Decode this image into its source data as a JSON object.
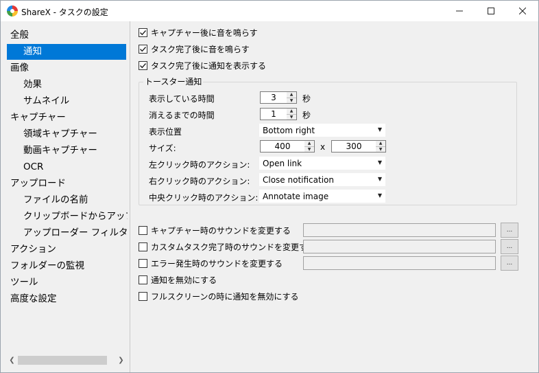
{
  "window": {
    "title": "ShareX - タスクの設定"
  },
  "nav": {
    "items": [
      {
        "label": "全般"
      },
      {
        "label": "通知"
      },
      {
        "label": "画像"
      },
      {
        "label": "効果"
      },
      {
        "label": "サムネイル"
      },
      {
        "label": "キャプチャー"
      },
      {
        "label": "領域キャプチャー"
      },
      {
        "label": "動画キャプチャー"
      },
      {
        "label": "OCR"
      },
      {
        "label": "アップロード"
      },
      {
        "label": "ファイルの名前"
      },
      {
        "label": "クリップボードからアップロー"
      },
      {
        "label": "アップローダー フィルター:"
      },
      {
        "label": "アクション"
      },
      {
        "label": "フォルダーの監視"
      },
      {
        "label": "ツール"
      },
      {
        "label": "高度な設定"
      }
    ],
    "selected": "通知"
  },
  "main": {
    "checks_top": [
      {
        "label": "キャプチャー後に音を鳴らす",
        "checked": true
      },
      {
        "label": "タスク完了後に音を鳴らす",
        "checked": true
      },
      {
        "label": "タスク完了後に通知を表示する",
        "checked": true
      }
    ],
    "toast": {
      "legend": "トースター通知",
      "display_time_label": "表示している時間",
      "display_time_value": "3",
      "display_time_unit": "秒",
      "fade_time_label": "消えるまでの時間",
      "fade_time_value": "1",
      "fade_time_unit": "秒",
      "position_label": "表示位置",
      "position_value": "Bottom right",
      "size_label": "サイズ:",
      "size_width": "400",
      "size_sep": "x",
      "size_height": "300",
      "left_click_label": "左クリック時のアクション:",
      "left_click_value": "Open link",
      "right_click_label": "右クリック時のアクション:",
      "right_click_value": "Close notification",
      "middle_click_label": "中央クリック時のアクション:",
      "middle_click_value": "Annotate image"
    },
    "sound_rows": [
      {
        "label": "キャプチャー時のサウンドを変更する",
        "checked": false,
        "path": "",
        "browse": "..."
      },
      {
        "label": "カスタムタスク完了時のサウンドを変更する",
        "checked": false,
        "path": "",
        "browse": "..."
      },
      {
        "label": "エラー発生時のサウンドを変更する",
        "checked": false,
        "path": "",
        "browse": "..."
      }
    ],
    "checks_bottom": [
      {
        "label": "通知を無効にする",
        "checked": false
      },
      {
        "label": "フルスクリーンの時に通知を無効にする",
        "checked": false
      }
    ]
  },
  "colors": {
    "accent": "#0078d7",
    "panel": "#f0f0f0"
  }
}
